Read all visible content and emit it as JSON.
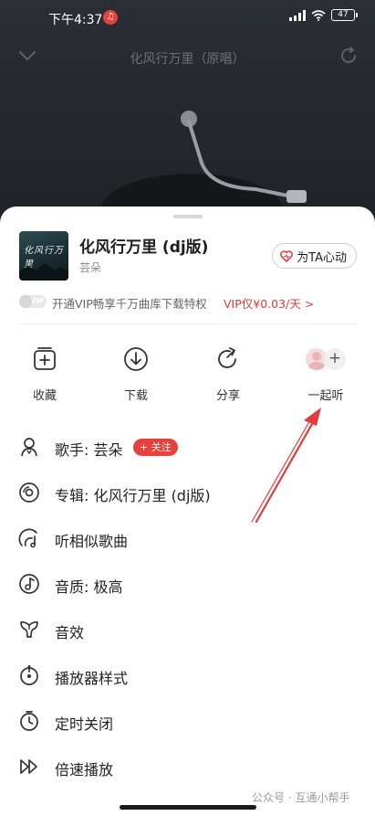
{
  "status": {
    "time": "下午4:37",
    "battery": "47",
    "app_badge": "♫"
  },
  "player": {
    "title": "化风行万里（原唱）"
  },
  "song": {
    "title": "化风行万里 (dj版)",
    "artist": "芸朵",
    "cover_text": "化风行万里",
    "heart_button": "为TA心动"
  },
  "vip": {
    "badge": "VIP",
    "text": "开通VIP畅享千万曲库下载特权",
    "price": "VIP仅¥0.03/天 >"
  },
  "actions": [
    {
      "label": "收藏",
      "icon": "add-to-collection-icon"
    },
    {
      "label": "下载",
      "icon": "download-icon"
    },
    {
      "label": "分享",
      "icon": "share-icon"
    },
    {
      "label": "一起听",
      "icon": "listen-together-icon"
    }
  ],
  "menu": [
    {
      "label": "歌手: 芸朵",
      "icon": "singer-icon",
      "badge": "+ 关注"
    },
    {
      "label": "专辑: 化风行万里 (dj版)",
      "icon": "album-icon"
    },
    {
      "label": "听相似歌曲",
      "icon": "similar-songs-icon"
    },
    {
      "label": "音质: 极高",
      "icon": "quality-icon"
    },
    {
      "label": "音效",
      "icon": "sound-effect-icon"
    },
    {
      "label": "播放器样式",
      "icon": "player-style-icon"
    },
    {
      "label": "定时关闭",
      "icon": "timer-icon"
    },
    {
      "label": "倍速播放",
      "icon": "speed-icon"
    }
  ],
  "watermark": "公众号 · 互通小帮手",
  "colors": {
    "accent": "#e8413b",
    "sheet_bg": "#ffffff",
    "player_bg": "#23262c"
  }
}
